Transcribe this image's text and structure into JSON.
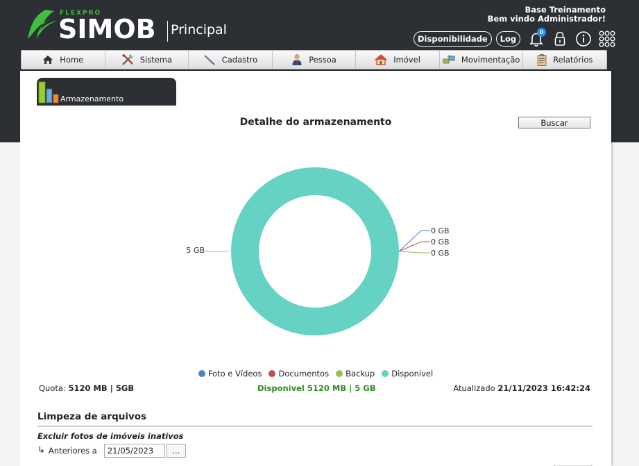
{
  "header": {
    "brand_small": "FLEXPRO",
    "brand": "SIMOB",
    "section": "Principal",
    "org": "Base Treinamento",
    "welcome": "Bem vindo Administrador!",
    "disponibilidade_label": "Disponibilidade",
    "log_label": "Log",
    "notification_count": "0"
  },
  "nav": {
    "items": [
      {
        "label": "Home",
        "icon": "home-icon"
      },
      {
        "label": "Sistema",
        "icon": "tools-icon"
      },
      {
        "label": "Cadastro",
        "icon": "pen-icon"
      },
      {
        "label": "Pessoa",
        "icon": "person-icon"
      },
      {
        "label": "Imóvel",
        "icon": "house-icon"
      },
      {
        "label": "Movimentação",
        "icon": "transfer-icon"
      },
      {
        "label": "Relatórios",
        "icon": "clipboard-icon"
      }
    ]
  },
  "module": {
    "label": "Armazenamento",
    "icon": "bar-chart-icon"
  },
  "main": {
    "title": "Detalhe do armazenamento",
    "search_label": "Buscar"
  },
  "chart_data": {
    "type": "pie",
    "style": "donut",
    "title": "",
    "categories": [
      "Foto e Vídeos",
      "Documentos",
      "Backup",
      "Disponivel"
    ],
    "values": [
      0,
      0,
      0,
      5
    ],
    "unit": "GB",
    "data_labels": [
      "0 GB",
      "0 GB",
      "0 GB",
      "5 GB"
    ],
    "colors": [
      "#4f81bd",
      "#c0504d",
      "#9bbb59",
      "#66d2c4"
    ],
    "legend_position": "bottom"
  },
  "stats": {
    "quota_label": "Quota:",
    "quota_value": "5120 MB | 5GB",
    "disponivel": "Disponivel 5120 MB | 5 GB",
    "updated_label": "Atualizado",
    "updated_value": "21/11/2023 16:42:24"
  },
  "cleanup": {
    "title": "Limpeza de arquivos",
    "subtitle": "Excluir fotos de imóveis inativos",
    "before_label": "Anteriores a",
    "date_value": "21/05/2023",
    "picker_label": "..."
  },
  "colors": {
    "header_bg": "#2c2f33",
    "brand_green": "#3fbf3f",
    "available_green": "#2e8b22",
    "accent_blue": "#1e90ff"
  }
}
